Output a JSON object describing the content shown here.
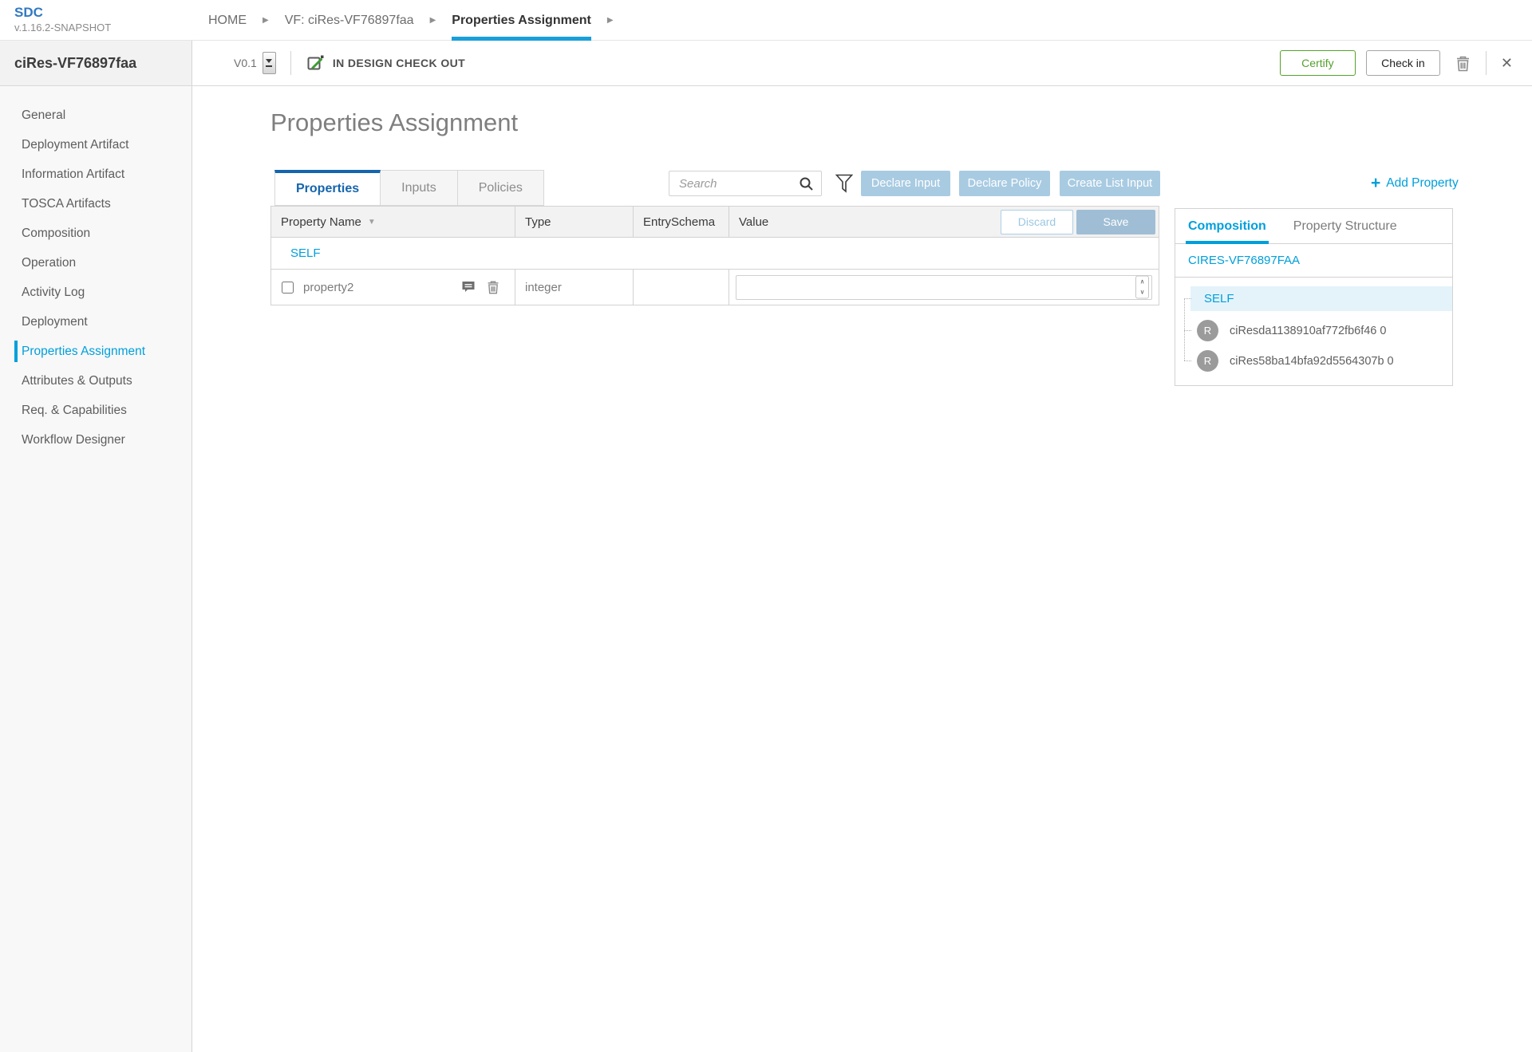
{
  "app": {
    "name": "SDC",
    "version": "v.1.16.2-SNAPSHOT"
  },
  "breadcrumbs": {
    "items": [
      {
        "label": "HOME",
        "active": false
      },
      {
        "label": "VF: ciRes-VF76897faa",
        "active": false
      },
      {
        "label": "Properties Assignment",
        "active": true
      }
    ]
  },
  "toolbar": {
    "entity_name": "ciRes-VF76897faa",
    "version": "V0.1",
    "lifecycle_state": "IN DESIGN CHECK OUT",
    "certify_label": "Certify",
    "checkin_label": "Check in"
  },
  "sidebar": {
    "items": [
      {
        "label": "General",
        "active": false
      },
      {
        "label": "Deployment Artifact",
        "active": false
      },
      {
        "label": "Information Artifact",
        "active": false
      },
      {
        "label": "TOSCA Artifacts",
        "active": false
      },
      {
        "label": "Composition",
        "active": false
      },
      {
        "label": "Operation",
        "active": false
      },
      {
        "label": "Activity Log",
        "active": false
      },
      {
        "label": "Deployment",
        "active": false
      },
      {
        "label": "Properties Assignment",
        "active": true
      },
      {
        "label": "Attributes & Outputs",
        "active": false
      },
      {
        "label": "Req. & Capabilities",
        "active": false
      },
      {
        "label": "Workflow Designer",
        "active": false
      }
    ]
  },
  "main": {
    "title": "Properties Assignment",
    "tabs": [
      {
        "label": "Properties",
        "active": true
      },
      {
        "label": "Inputs",
        "active": false
      },
      {
        "label": "Policies",
        "active": false
      }
    ],
    "search": {
      "placeholder": "Search",
      "value": ""
    },
    "actions": [
      {
        "label": "Declare Input"
      },
      {
        "label": "Declare Policy"
      },
      {
        "label": "Create List Input"
      }
    ],
    "add_property_label": "Add Property",
    "table": {
      "columns": [
        "Property Name",
        "Type",
        "EntrySchema",
        "Value"
      ],
      "discard_label": "Discard",
      "save_label": "Save",
      "group_label": "SELF",
      "rows": [
        {
          "name": "property2",
          "type": "integer",
          "entry_schema": "",
          "value": "",
          "checked": false
        }
      ]
    }
  },
  "right_panel": {
    "tabs": [
      {
        "label": "Composition",
        "active": true
      },
      {
        "label": "Property Structure",
        "active": false
      }
    ],
    "root_label": "CIRES-VF76897FAA",
    "self_label": "SELF",
    "nodes": [
      {
        "initial": "R",
        "label": "ciResda1138910af772fb6f46 0"
      },
      {
        "initial": "R",
        "label": "ciRes58ba14bfa92d5564307b 0"
      }
    ]
  },
  "icons": {
    "breadcrumb_arrow": "▶",
    "sort_desc": "▼",
    "close": "✕",
    "plus": "+",
    "chevron_up": "∧",
    "chevron_down": "∨"
  },
  "colors": {
    "primary_blue": "#009fdb",
    "tab_active_blue": "#1565ad",
    "action_button_blue": "#a8cbe2",
    "save_button_blue": "#9fbed5",
    "certify_green": "#55a02c",
    "logo_blue": "#3179c2",
    "selected_tree_bg": "#e4f3fa"
  }
}
